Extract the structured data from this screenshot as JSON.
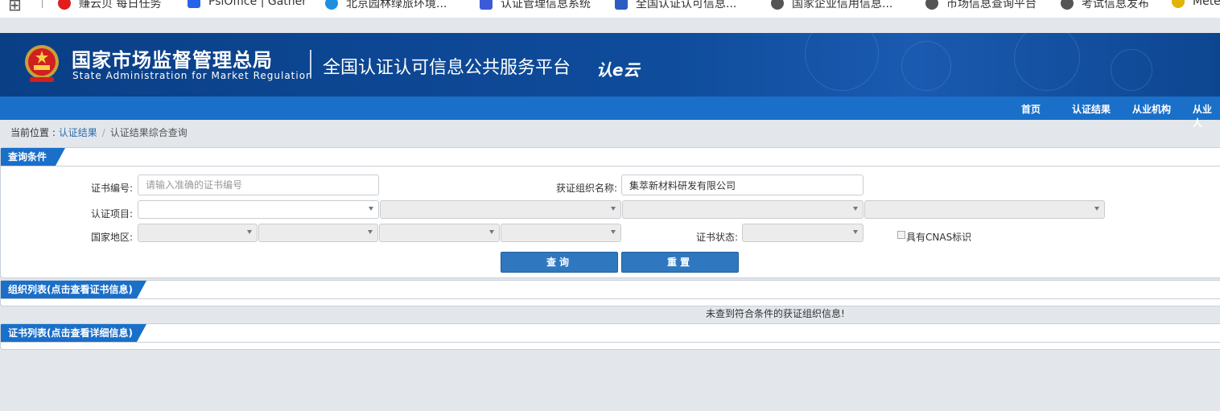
{
  "bookmarks": [
    {
      "label": "赚云贝 每日任务",
      "color": "#e11d1d"
    },
    {
      "label": "PsiOffice | Gather",
      "color": "#2563eb"
    },
    {
      "label": "北京园林绿旅环境...",
      "color": "#1d8fe0"
    },
    {
      "label": "认证管理信息系统",
      "color": "#3b5ad6"
    },
    {
      "label": "全国认证认可信息...",
      "color": "#2a5cc2"
    },
    {
      "label": "国家企业信用信息...",
      "color": "#555555"
    },
    {
      "label": "市场信息查询平台",
      "color": "#555555"
    },
    {
      "label": "考试信息发布",
      "color": "#555555"
    },
    {
      "label": "Mete",
      "color": "#e0b400"
    }
  ],
  "header": {
    "org_cn": "国家市场监督管理总局",
    "org_en": "State Administration  for  Market Regulation",
    "platform": "全国认证认可信息公共服务平台",
    "logo_mark": "认e云"
  },
  "nav": {
    "items": [
      "首页",
      "认证结果",
      "从业机构",
      "从业人"
    ]
  },
  "breadcrumb": {
    "prefix": "当前位置 : ",
    "link": "认证结果",
    "separator": "/",
    "current": "认证结果综合查询"
  },
  "query_panel": {
    "title": "查询条件",
    "cert_no_label": "证书编号:",
    "cert_no_placeholder": "请输入准确的证书编号",
    "cert_no_value": "",
    "org_name_label": "获证组织名称:",
    "org_name_value": "集萃新材料研发有限公司",
    "project_label": "认证项目:",
    "region_label": "国家地区:",
    "status_label": "证书状态:",
    "cnas_label": "具有CNAS标识",
    "query_button": "查询",
    "reset_button": "重置"
  },
  "org_list": {
    "title": "组织列表(点击查看证书信息)",
    "empty_message": "未查到符合条件的获证组织信息!"
  },
  "cert_list": {
    "title": "证书列表(点击查看详细信息)"
  },
  "colors": {
    "nav_bar": "#1a6fc9",
    "header_bg": "#0f4c9c",
    "button": "#2f78bf",
    "page_bg": "#e3e7ec"
  }
}
